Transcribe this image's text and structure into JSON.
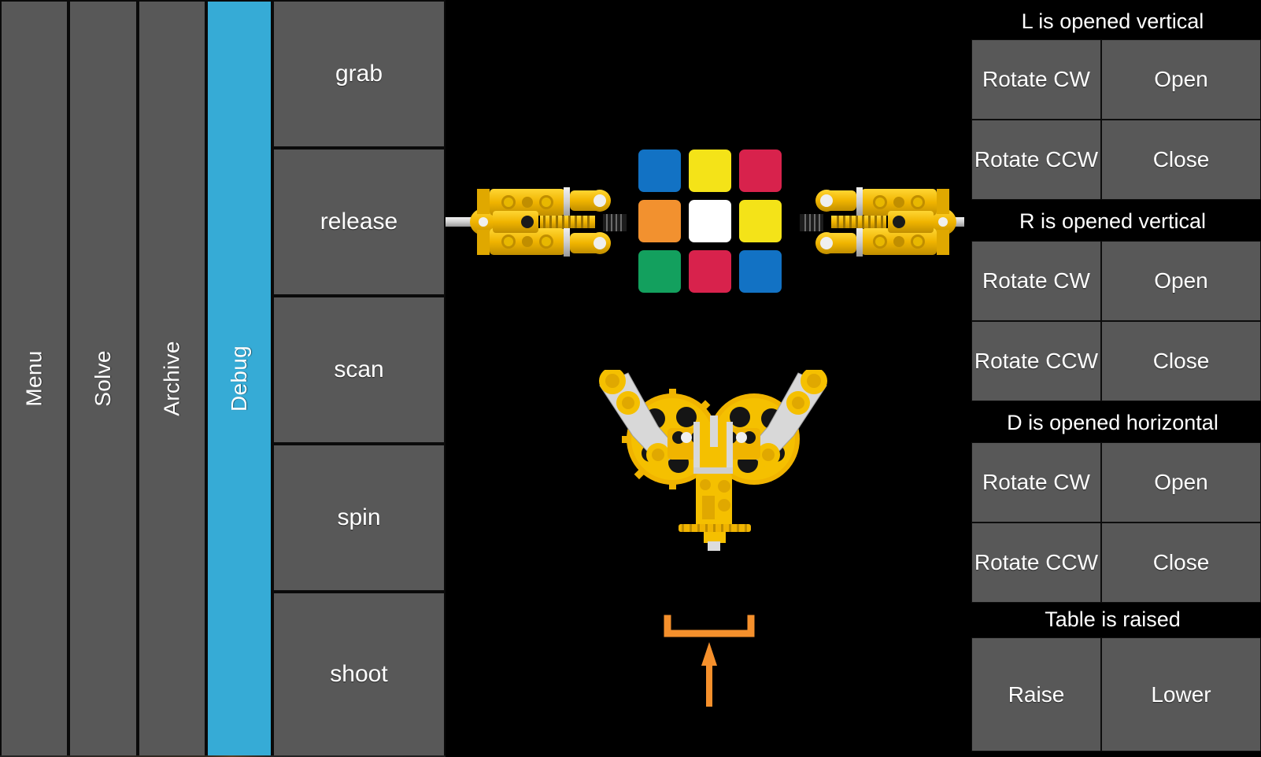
{
  "app": {
    "background_color": "#000000",
    "panel_color": "#585858",
    "active_tab_color": "#36abd6",
    "text_color": "#ffffff",
    "accent_color": "#f5902c"
  },
  "nav_tabs": [
    {
      "label": "Menu",
      "active": false
    },
    {
      "label": "Solve",
      "active": false
    },
    {
      "label": "Archive",
      "active": false
    },
    {
      "label": "Debug",
      "active": true
    }
  ],
  "actions": [
    {
      "label": "grab"
    },
    {
      "label": "release"
    },
    {
      "label": "scan"
    },
    {
      "label": "spin"
    },
    {
      "label": "shoot"
    }
  ],
  "cube": {
    "rows": [
      [
        "#1272c4",
        "#f4e318",
        "#d8224c"
      ],
      [
        "#f2912f",
        "#ffffff",
        "#f4e318"
      ],
      [
        "#13a05e",
        "#d8224c",
        "#1272c4"
      ]
    ]
  },
  "robot": {
    "left_arm": "robot-arm-left",
    "right_arm": "robot-arm-right",
    "gripper": "gripper-mechanism",
    "table_indicator": "table-raise-arrow"
  },
  "control_panel": {
    "groups": [
      {
        "status": "L is opened vertical",
        "buttons": [
          {
            "label": "Rotate CW",
            "name": "l-rotate-cw"
          },
          {
            "label": "Open",
            "name": "l-open"
          },
          {
            "label": "Rotate CCW",
            "name": "l-rotate-ccw"
          },
          {
            "label": "Close",
            "name": "l-close"
          }
        ]
      },
      {
        "status": "R is opened vertical",
        "buttons": [
          {
            "label": "Rotate CW",
            "name": "r-rotate-cw"
          },
          {
            "label": "Open",
            "name": "r-open"
          },
          {
            "label": "Rotate CCW",
            "name": "r-rotate-ccw"
          },
          {
            "label": "Close",
            "name": "r-close"
          }
        ]
      },
      {
        "status": "D is opened horizontal",
        "buttons": [
          {
            "label": "Rotate CW",
            "name": "d-rotate-cw"
          },
          {
            "label": "Open",
            "name": "d-open"
          },
          {
            "label": "Rotate CCW",
            "name": "d-rotate-ccw"
          },
          {
            "label": "Close",
            "name": "d-close"
          }
        ]
      },
      {
        "status": "Table is raised",
        "buttons": [
          {
            "label": "Raise",
            "name": "table-raise"
          },
          {
            "label": "Lower",
            "name": "table-lower"
          }
        ]
      }
    ]
  }
}
